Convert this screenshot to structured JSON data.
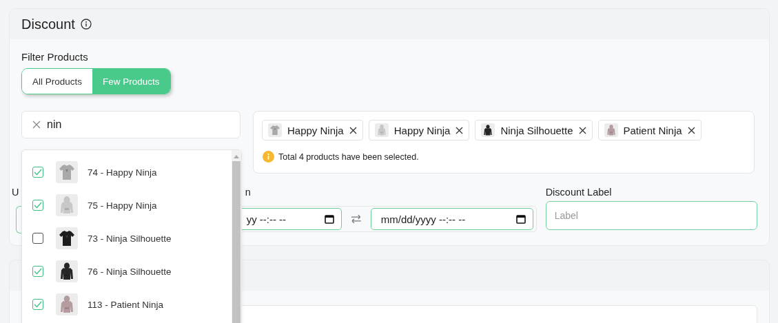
{
  "card": {
    "title": "Discount"
  },
  "filter": {
    "label": "Filter Products",
    "tabs": [
      {
        "label": "All Products",
        "selected": false
      },
      {
        "label": "Few Products",
        "selected": true
      }
    ]
  },
  "search": {
    "value": "nin"
  },
  "results": [
    {
      "label": "74 - Happy Ninja",
      "checked": true
    },
    {
      "label": "75 - Happy Ninja",
      "checked": true
    },
    {
      "label": "73 - Ninja Silhouette",
      "checked": false
    },
    {
      "label": "76 - Ninja Silhouette",
      "checked": true
    },
    {
      "label": "113 - Patient Ninja",
      "checked": true
    }
  ],
  "selected_products": [
    {
      "label": "Happy Ninja"
    },
    {
      "label": "Happy Ninja"
    },
    {
      "label": "Ninja Silhouette"
    },
    {
      "label": "Patient Ninja"
    }
  ],
  "selection_note": "Total 4 products have been selected.",
  "usage": {
    "label": "U"
  },
  "schedule": {
    "label": "n",
    "start": "yy --:-- --",
    "end": "mm/dd/yyyy --:-- --"
  },
  "discount_label": {
    "label": "Discount Label",
    "placeholder": "Label"
  }
}
